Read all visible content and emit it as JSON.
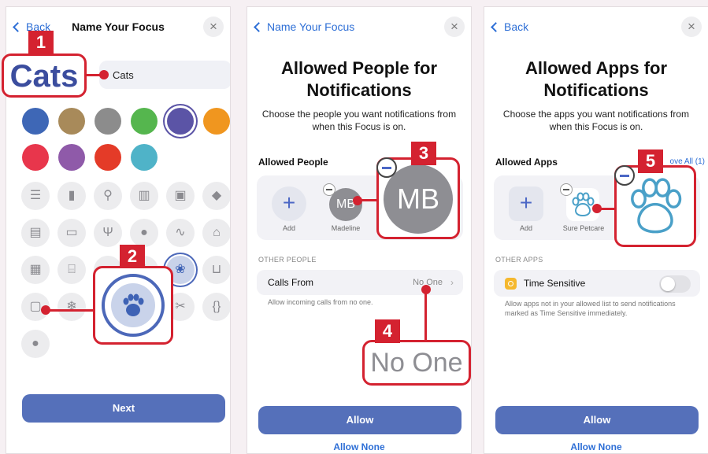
{
  "panel1": {
    "back": "Back",
    "title": "Name Your Focus",
    "close_icon": "×",
    "focus_name": "Cats",
    "callout_text": "Cats",
    "step1": "1",
    "step2": "2",
    "next": "Next",
    "colors": [
      "#3e67b6",
      "#a88a5a",
      "#8c8c8c",
      "#55b64e",
      "#5b54a6",
      "#f0961f",
      "#e8364c",
      "#8f5aa9",
      "#e43b28",
      "#4fb3c8"
    ],
    "icons": [
      "list-icon",
      "bookmark-icon",
      "pin-icon",
      "books-icon",
      "gift-icon",
      "graduation-cap-icon",
      "document-icon",
      "credit-card-icon",
      "fork-knife-icon",
      "pills-icon",
      "stethoscope-icon",
      "house-icon",
      "building-icon",
      "bank-icon",
      "bed-icon",
      "person-icon",
      "paw-icon",
      "cart-icon",
      "train-icon",
      "snowflake-icon",
      "flame-icon",
      "briefcase-icon",
      "scissors-icon",
      "braces-icon",
      "lightbulb-icon"
    ]
  },
  "panel2": {
    "back": "Name Your Focus",
    "close_icon": "×",
    "title_line1": "Allowed People for",
    "title_line2": "Notifications",
    "desc_line1": "Choose the people you want notifications from",
    "desc_line2": "when this Focus is on.",
    "section": "Allowed People",
    "add_label": "Add",
    "person_initials": "MB",
    "person_name": "Madeline",
    "other_header": "OTHER PEOPLE",
    "calls_from": "Calls From",
    "calls_value": "No One",
    "calls_note": "Allow incoming calls from no one.",
    "callout_mb": "MB",
    "callout_no_one": "No One",
    "step3": "3",
    "step4": "4",
    "allow": "Allow",
    "allow_none": "Allow None"
  },
  "panel3": {
    "back": "Back",
    "close_icon": "×",
    "title_line1": "Allowed Apps for",
    "title_line2": "Notifications",
    "desc_line1": "Choose the apps you want notifications from",
    "desc_line2": "when this Focus is on.",
    "section": "Allowed Apps",
    "section_right": "ove All (1)",
    "add_label": "Add",
    "app_name": "Sure Petcare",
    "other_header": "OTHER APPS",
    "time_sensitive": "Time Sensitive",
    "ts_note_line1": "Allow apps not in your allowed list to send notifications",
    "ts_note_line2": "marked as Time Sensitive immediately.",
    "step5": "5",
    "allow": "Allow",
    "allow_none": "Allow None"
  }
}
